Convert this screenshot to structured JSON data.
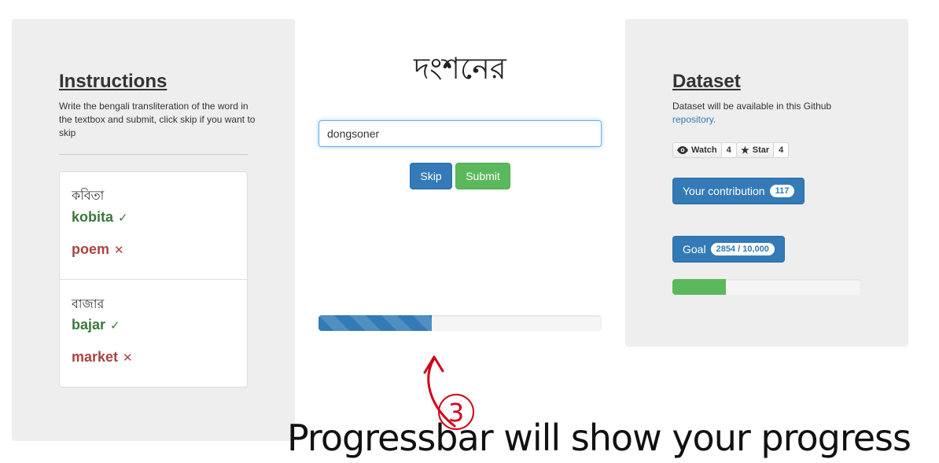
{
  "instructions": {
    "title": "Instructions",
    "text": "Write the bengali transliteration of the word in the textbox and submit, click skip if you want to skip"
  },
  "examples": [
    {
      "bengali": "কবিতা",
      "correct": "kobita",
      "wrong": "poem"
    },
    {
      "bengali": "বাজার",
      "correct": "bajar",
      "wrong": "market"
    }
  ],
  "marks": {
    "correct": "✓",
    "wrong": "✕"
  },
  "task": {
    "word": "দংশনের",
    "input_value": "dongsoner",
    "skip_label": "Skip",
    "submit_label": "Submit",
    "progress_fraction": 0.4
  },
  "dataset": {
    "title": "Dataset",
    "text": "Dataset will be available in this Github",
    "link_text": "repository.",
    "watch_label": "Watch",
    "watch_count": "4",
    "star_label": "Star",
    "star_count": "4",
    "contribution_label": "Your contribution",
    "contribution_count": "117",
    "goal_label": "Goal",
    "goal_value": "2854 / 10,000",
    "goal_fraction": 0.2854
  },
  "annotation": {
    "number": "3",
    "caption": "Progressbar will show your progress",
    "color": "#d0021b"
  },
  "colors": {
    "primary": "#337ab7",
    "success": "#5cb85c",
    "panel": "#eeeeee",
    "correct_text": "#3c763d",
    "wrong_text": "#a94442"
  }
}
